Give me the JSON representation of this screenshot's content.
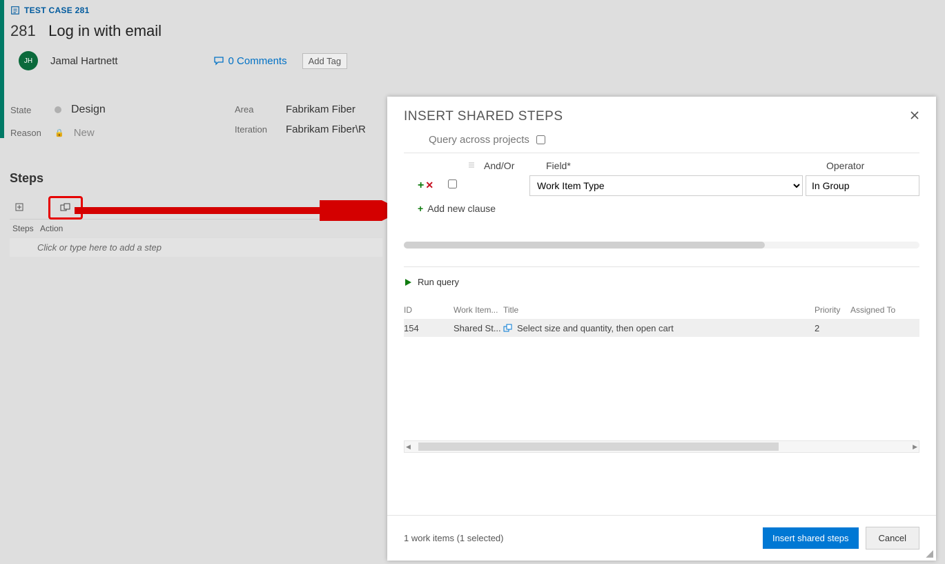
{
  "workitem": {
    "type_line": "TEST CASE 281",
    "id": "281",
    "title": "Log in with email",
    "avatar_initials": "JH",
    "owner": "Jamal Hartnett",
    "comments_label": "0 Comments",
    "add_tag": "Add Tag",
    "state_label": "State",
    "state_value": "Design",
    "reason_label": "Reason",
    "reason_value": "New",
    "area_label": "Area",
    "area_value": "Fabrikam Fiber",
    "iteration_label": "Iteration",
    "iteration_value": "Fabrikam Fiber\\R"
  },
  "steps": {
    "heading": "Steps",
    "col_steps": "Steps",
    "col_action": "Action",
    "placeholder_row": "Click or type here to add a step"
  },
  "dialog": {
    "title": "INSERT SHARED STEPS",
    "qap_label": "Query across projects",
    "hdr_andor": "And/Or",
    "hdr_field": "Field*",
    "hdr_operator": "Operator",
    "clause_field_value": "Work Item Type",
    "clause_operator_value": "In Group",
    "add_clause": "Add new clause",
    "run_query": "Run query",
    "cols": {
      "id": "ID",
      "type": "Work Item...",
      "title": "Title",
      "priority": "Priority",
      "assigned": "Assigned To"
    },
    "row": {
      "id": "154",
      "type": "Shared St...",
      "title": "Select size and quantity, then open cart",
      "priority": "2",
      "assigned": ""
    },
    "footer_status": "1 work items (1 selected)",
    "btn_insert": "Insert shared steps",
    "btn_cancel": "Cancel"
  }
}
